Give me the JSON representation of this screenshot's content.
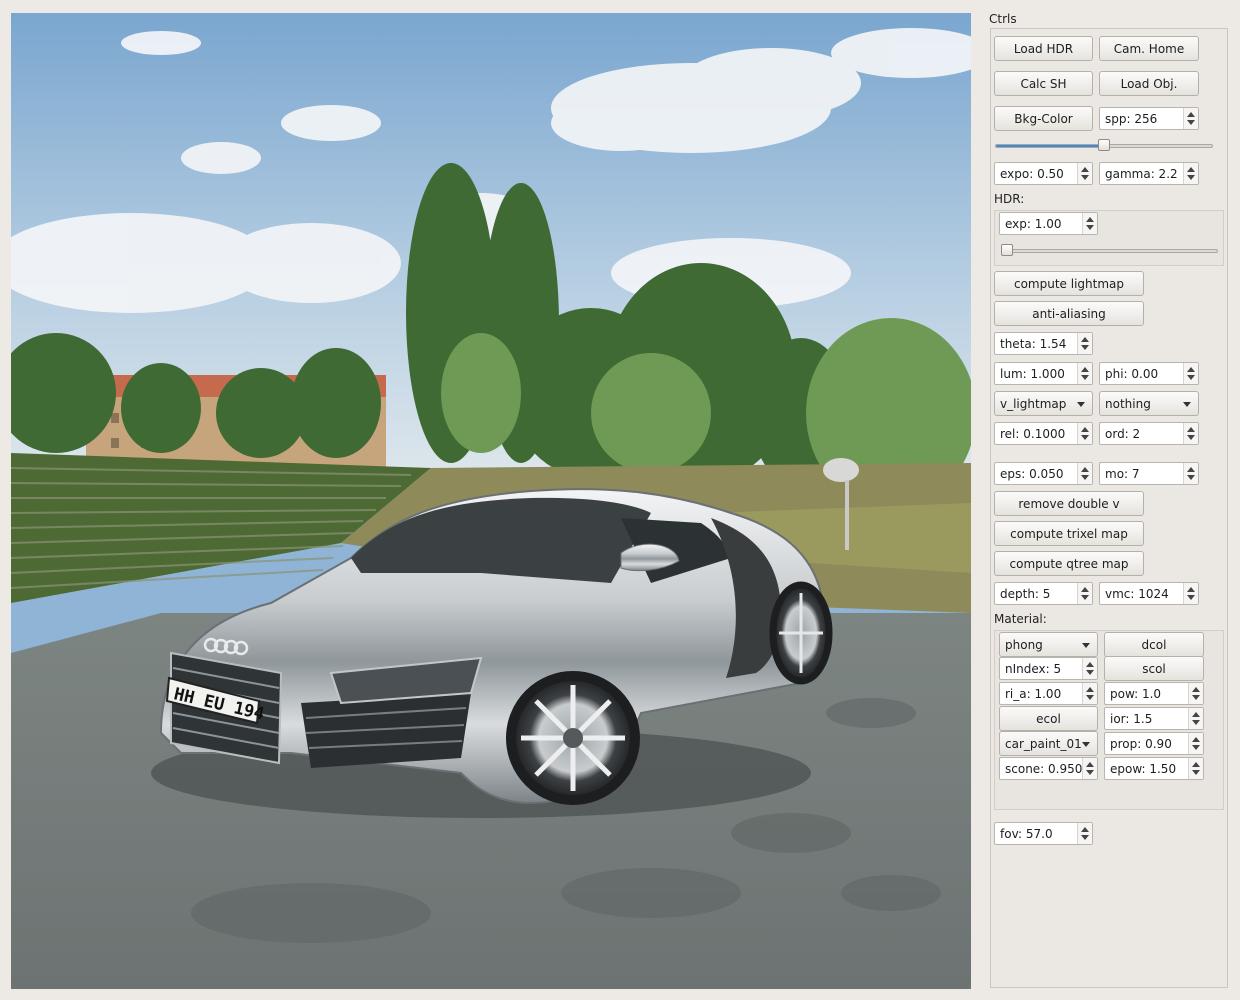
{
  "panel": {
    "title": "Ctrls"
  },
  "buttons": {
    "load_hdr": "Load HDR",
    "cam_home": "Cam. Home",
    "calc_sh": "Calc SH",
    "load_obj": "Load Obj.",
    "bkg_color": "Bkg-Color",
    "compute_lightmap": "compute lightmap",
    "anti_aliasing": "anti-aliasing",
    "remove_double_v": "remove double v",
    "compute_trixel_map": "compute trixel map",
    "compute_qtree_map": "compute qtree map"
  },
  "render": {
    "spp": "spp: 256",
    "spp_slider_fraction": 0.5,
    "expo": "expo: 0.50",
    "gamma": "gamma: 2.2"
  },
  "hdr": {
    "label": "HDR:",
    "exp": "exp: 1.00",
    "exp_slider_fraction": 0.0
  },
  "lightmap": {
    "theta": "theta: 1.54",
    "lum": "lum: 1.000",
    "phi": "phi: 0.00",
    "mode_select": "v_lightmap",
    "filter_select": "nothing",
    "rel": "rel: 0.1000",
    "ord": "ord: 2",
    "eps": "eps: 0.050",
    "mo": "mo: 7",
    "depth": "depth: 5",
    "vmc": "vmc: 1024"
  },
  "material": {
    "label": "Material:",
    "shader_select": "phong",
    "dcol": "dcol",
    "nindex": "nIndex: 5",
    "scol": "scol",
    "ri_a": "ri_a: 1.00",
    "pow": "pow: 1.0",
    "ecol": "ecol",
    "ior": "ior: 1.5",
    "material_select": "car_paint_01",
    "prop": "prop: 0.90",
    "scone": "scone: 0.950",
    "epow": "epow: 1.50"
  },
  "camera": {
    "fov": "fov: 57.0"
  },
  "scene": {
    "license_plate": "HH EU 194"
  },
  "colors": {
    "accent": "#3f8ad8",
    "panel_bg": "#edeae5"
  }
}
